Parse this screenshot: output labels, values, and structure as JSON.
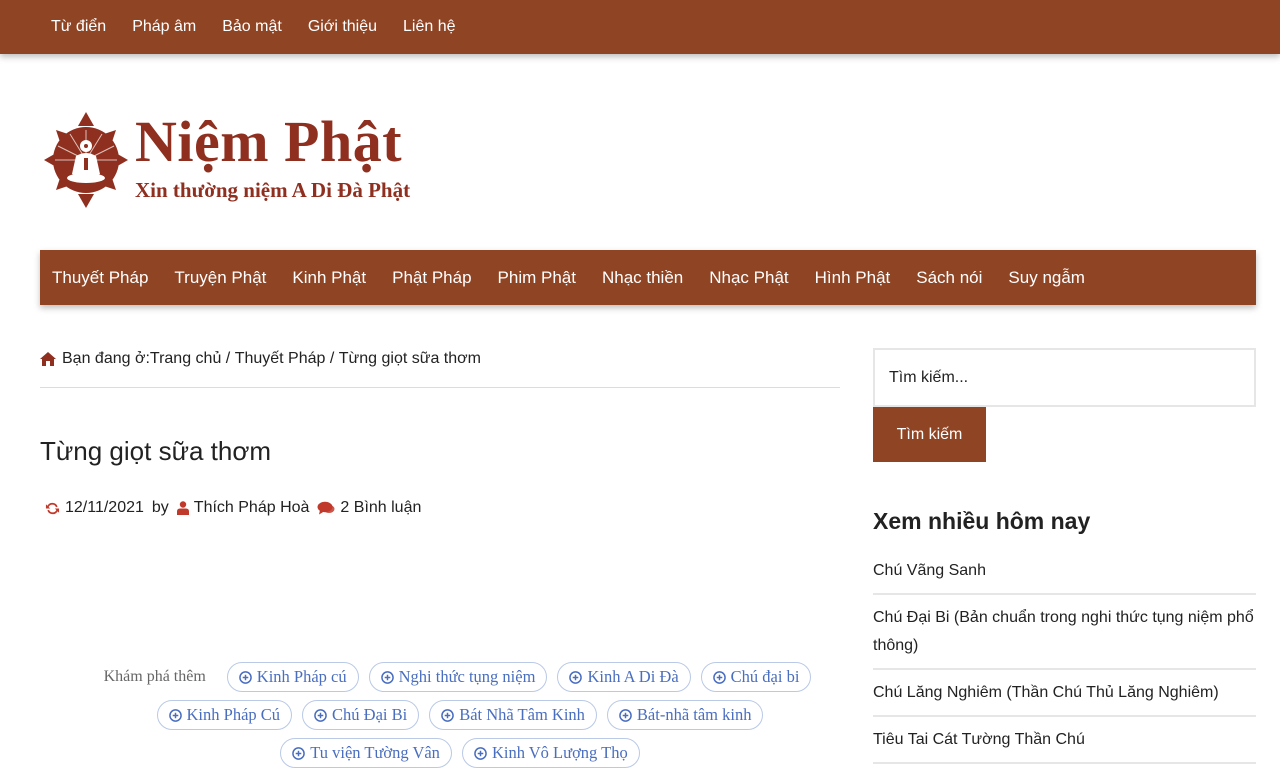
{
  "top_menu": [
    "Từ điển",
    "Pháp âm",
    "Bảo mật",
    "Giới thiệu",
    "Liên hệ"
  ],
  "logo": {
    "title": "Niệm Phật",
    "slogan": "Xin thường niệm A Di Đà Phật"
  },
  "main_menu": [
    "Thuyết Pháp",
    "Truyện Phật",
    "Kinh Phật",
    "Phật Pháp",
    "Phim Phật",
    "Nhạc thiền",
    "Nhạc Phật",
    "Hình Phật",
    "Sách nói",
    "Suy ngẫm"
  ],
  "breadcrumb": {
    "prefix": "Bạn đang ở:",
    "home": "Trang chủ",
    "sep": " / ",
    "category": "Thuyết Pháp",
    "current": "Từng giọt sữa thơm"
  },
  "post": {
    "title": "Từng giọt sữa thơm",
    "date": "12/11/2021",
    "by": "by",
    "author": "Thích Pháp Hoà",
    "comments": "2 Bình luận"
  },
  "explore": {
    "label": "Khám phá thêm",
    "tags": [
      "Kinh Pháp cú",
      "Nghi thức tụng niệm",
      "Kinh A Di Đà",
      "Chú đại bi",
      "Kinh Pháp Cú",
      "Chú Đại Bi",
      "Bát Nhã Tâm Kinh",
      "Bát-nhã tâm kinh",
      "Tu viện Tường Vân",
      "Kinh Vô Lượng Thọ"
    ]
  },
  "sidebar": {
    "search_placeholder": "Tìm kiếm...",
    "search_button": "Tìm kiếm",
    "widget_title": "Xem nhiều hôm nay",
    "popular": [
      "Chú Vãng Sanh",
      "Chú Đại Bi (Bản chuẩn trong nghi thức tụng niệm phổ thông)",
      "Chú Lăng Nghiêm (Thần Chú Thủ Lăng Nghiêm)",
      "Tiêu Tai Cát Tường Thần Chú"
    ]
  },
  "colors": {
    "brand": "#8f4424",
    "logo_red": "#8f2f20",
    "meta_icon": "#c0392b",
    "tag_blue": "#4a6ebf"
  },
  "icons": {
    "home": "home-icon",
    "refresh": "refresh-icon",
    "user": "user-icon",
    "comment": "comment-icon",
    "plus": "plus-circle-icon"
  }
}
